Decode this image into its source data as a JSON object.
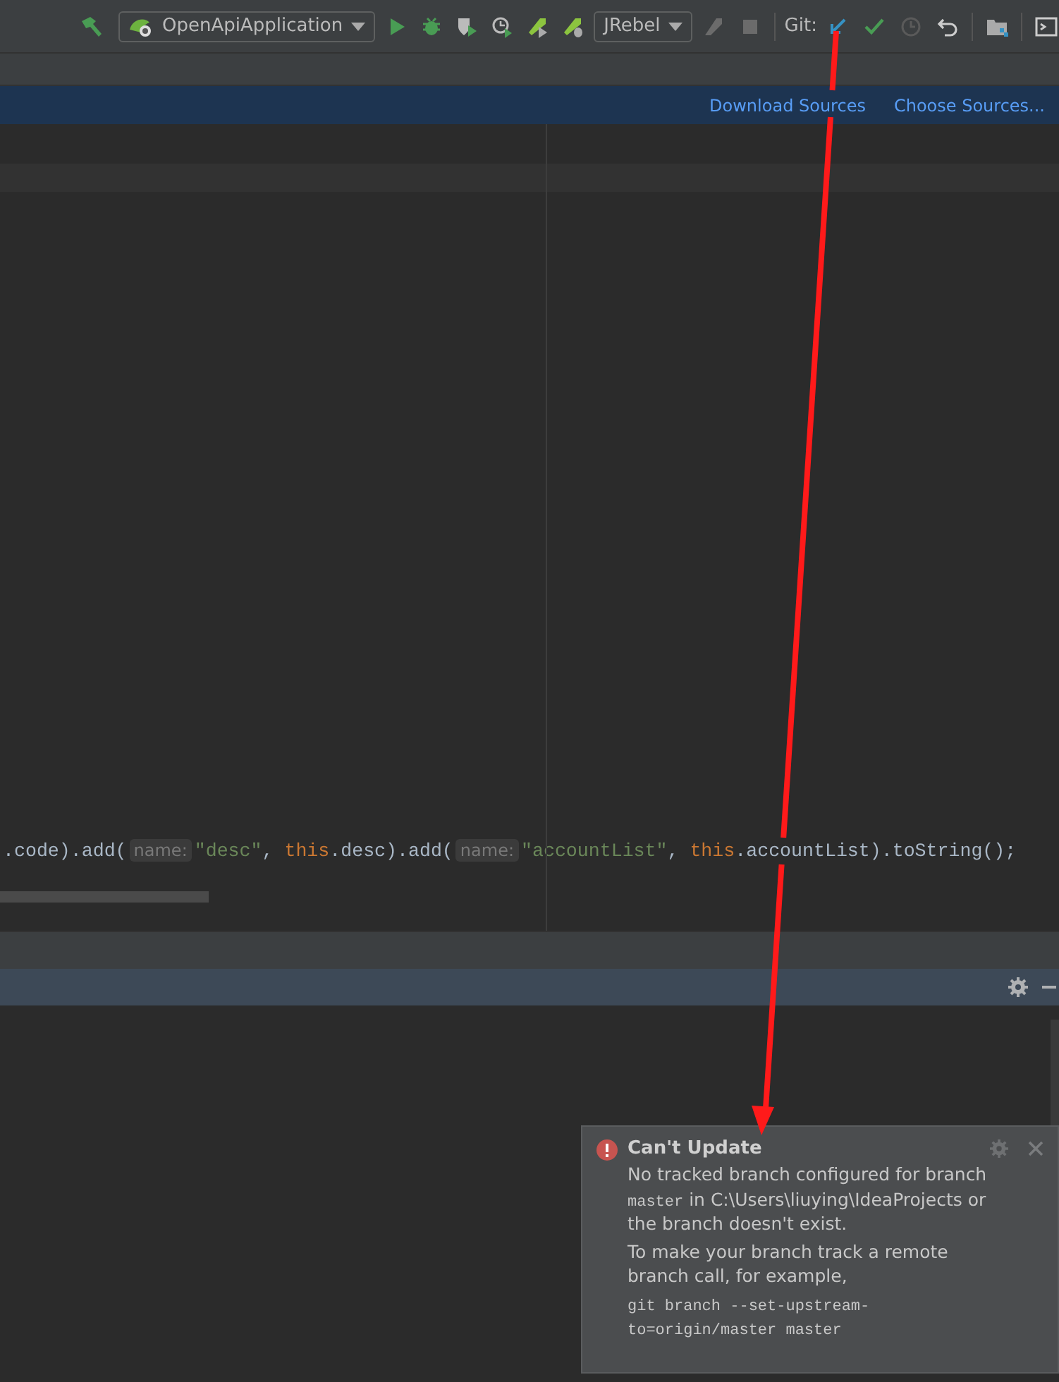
{
  "toolbar": {
    "run_config": "OpenApiApplication",
    "jrebel_config": "JRebel",
    "git_label": "Git:",
    "run_tools": [
      {
        "kind": "run",
        "disabled": false
      },
      {
        "kind": "debug",
        "disabled": false
      },
      {
        "kind": "coverage",
        "disabled": false
      },
      {
        "kind": "profile",
        "disabled": false
      },
      {
        "kind": "rocket-run",
        "disabled": false
      },
      {
        "kind": "rocket-debug",
        "disabled": false
      }
    ],
    "jrebel_tools": [
      {
        "kind": "rocket",
        "disabled": true
      },
      {
        "kind": "stop",
        "disabled": true
      }
    ],
    "git_tools": [
      {
        "kind": "update",
        "disabled": false
      },
      {
        "kind": "commit",
        "disabled": false
      },
      {
        "kind": "history",
        "disabled": true
      },
      {
        "kind": "revert",
        "disabled": false
      }
    ]
  },
  "banner": {
    "links": [
      "Download Sources",
      "Choose Sources..."
    ]
  },
  "editor": {
    "code_line": [
      {
        "kind": "plain",
        "text": ".code).add("
      },
      {
        "kind": "hint",
        "text": "name:"
      },
      {
        "kind": "string",
        "text": "\"desc\""
      },
      {
        "kind": "plain",
        "text": ", "
      },
      {
        "kind": "keyword",
        "text": "this"
      },
      {
        "kind": "plain",
        "text": ".desc).add("
      },
      {
        "kind": "hint",
        "text": "name:"
      },
      {
        "kind": "string",
        "text": "\"accountList\""
      },
      {
        "kind": "plain",
        "text": ", "
      },
      {
        "kind": "keyword",
        "text": "this"
      },
      {
        "kind": "plain",
        "text": ".accountList).toString();"
      }
    ]
  },
  "notification": {
    "title": "Can't Update",
    "paragraphs": [
      [
        {
          "kind": "text",
          "text": "No tracked branch configured for branch "
        },
        {
          "kind": "code",
          "text": "master"
        },
        {
          "kind": "text",
          "text": " in C:\\Users\\liuying\\IdeaProjects or the branch doesn't exist."
        }
      ],
      [
        {
          "kind": "text",
          "text": "To make your branch track a remote branch call, for example,"
        }
      ],
      [
        {
          "kind": "code",
          "text": "git branch --set-upstream-to=origin/master master"
        }
      ]
    ]
  },
  "annotation": {
    "kind": "arrow"
  }
}
